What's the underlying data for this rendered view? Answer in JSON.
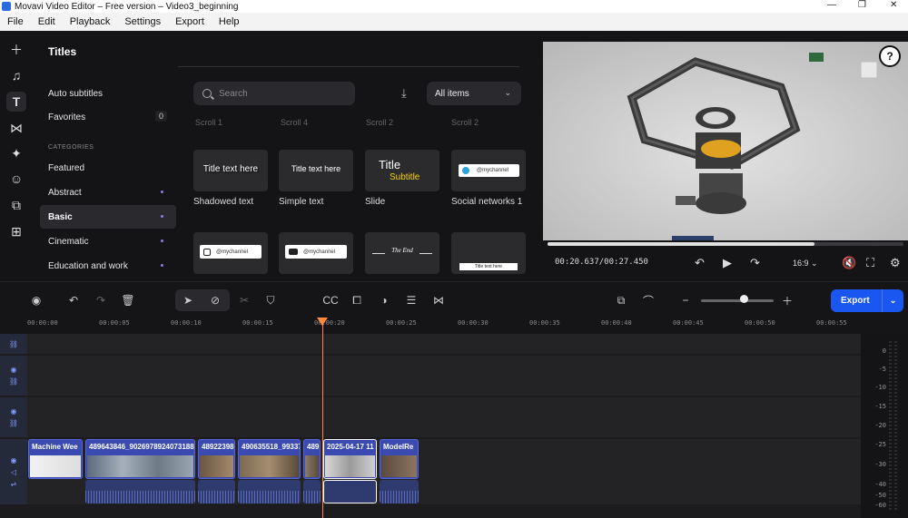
{
  "window": {
    "title": "Movavi Video Editor – Free version – Video3_beginning",
    "minimize": "—",
    "maximize": "❐",
    "close": "✕"
  },
  "menu": [
    "File",
    "Edit",
    "Playback",
    "Settings",
    "Export",
    "Help"
  ],
  "sidebar_icons": [
    "add-icon",
    "music-icon",
    "titles-icon",
    "transitions-icon",
    "effects-icon",
    "stickers-icon",
    "elements-icon",
    "more-icon"
  ],
  "panel": {
    "title": "Titles",
    "auto_subtitles": "Auto subtitles",
    "favorites": "Favorites",
    "favorites_count": "0",
    "categories_heading": "CATEGORIES",
    "categories": [
      "Featured",
      "Abstract",
      "Basic",
      "Cinematic",
      "Education and work"
    ],
    "selected_category": "Basic"
  },
  "search": {
    "placeholder": "Search"
  },
  "filter": {
    "selected": "All items"
  },
  "partial_labels": [
    "Scroll 1",
    "Scroll 4",
    "Scroll 2",
    "Scroll 2"
  ],
  "titles_row1": [
    {
      "label": "Shadowed text",
      "text": "Title text here"
    },
    {
      "label": "Simple text",
      "text": "Title text here"
    },
    {
      "label": "Slide",
      "text": "Title",
      "sub": "Subtitle"
    },
    {
      "label": "Social networks 1",
      "text": "@mychannel"
    }
  ],
  "titles_row2": [
    {
      "text": "@mychannel"
    },
    {
      "text": "@mychannel"
    },
    {
      "text": "The End"
    },
    {
      "text": "Title text here"
    }
  ],
  "player": {
    "time": "00:20.637/00:27.450",
    "aspect": "16:9",
    "progress": 0.75,
    "help": "?"
  },
  "toolbar": {
    "export_label": "Export"
  },
  "ruler": [
    "00:00:00",
    "00:00:05",
    "00:00:10",
    "00:00:15",
    "00:00:20",
    "00:00:25",
    "00:00:30",
    "00:00:35",
    "00:00:40",
    "00:00:45",
    "00:00:50",
    "00:00:55"
  ],
  "clips": [
    {
      "title": "Machine Wee"
    },
    {
      "title": "489643846_9026978924073188_"
    },
    {
      "title": "48922398"
    },
    {
      "title": "490635518_99337"
    },
    {
      "title": "489"
    },
    {
      "title": "2025-04-17 11"
    },
    {
      "title": "ModelRe"
    }
  ],
  "meter_labels": [
    "0",
    "-5",
    "-10",
    "-15",
    "-20",
    "-25",
    "-30",
    "-40",
    "-50",
    "-60"
  ],
  "colors": {
    "accent": "#1a56f0",
    "playhead": "#ff8a3c",
    "clip": "#3a4ab0"
  }
}
